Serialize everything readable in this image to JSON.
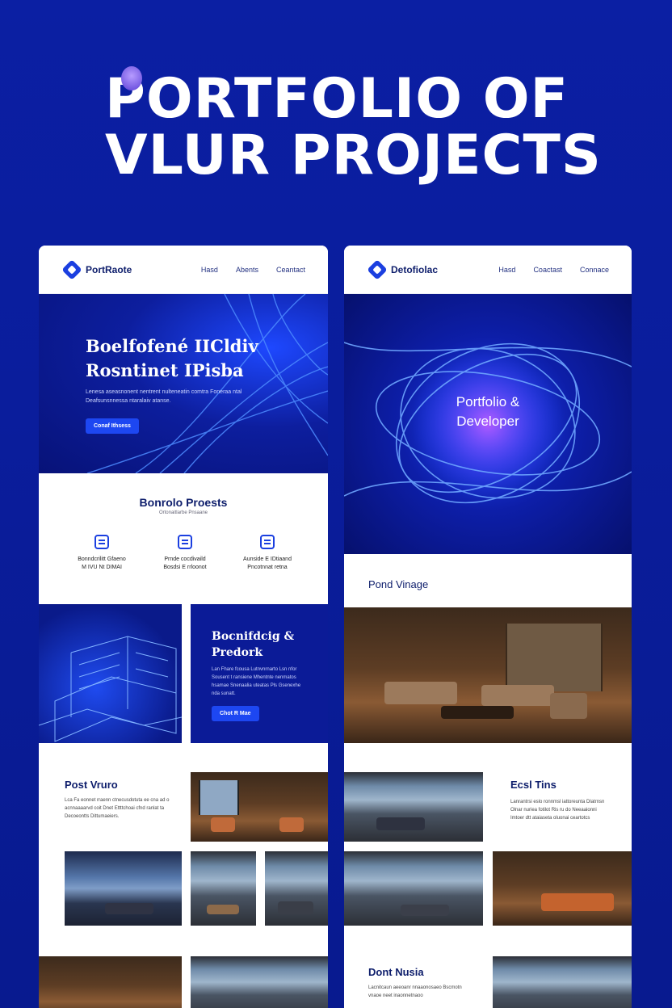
{
  "headline": {
    "line1": "PORTFOLIO OF",
    "line2": "VLUR PROJECTS"
  },
  "left_site": {
    "brand": "PortRaote",
    "nav": [
      "Hasd",
      "Abents",
      "Ceantact"
    ],
    "hero": {
      "title1": "Boelfofené IICldiv",
      "title2": "Rosntinet IPisba",
      "subtitle": "Lenesa aseasnonent nentrent nulteneatin comtra Foneraa ntal Deafsunsnnessa ntaralaiv atanse.",
      "button": "Conaf Ithsess"
    },
    "services": {
      "title": "Bonrolo Proests",
      "subtitle": "Ortonaitlarbe Pnsaane",
      "items": [
        {
          "t1": "Bonndcrilitt Gfaeno",
          "t2": "M IVU Nt DIMAI"
        },
        {
          "t1": "Prnde cocdivaild",
          "t2": "Bosdsi E rrloonot"
        },
        {
          "t1": "Aunside E IDtiaand",
          "t2": "Pncotnnat retna"
        }
      ]
    },
    "feature": {
      "title1": "Bocnifdcig &",
      "title2": "Predork",
      "subtitle": "Lan Fhare fcousa Lutnvnrnarto Lsn nfor Sousent t ransiene Mhentnte nenmatos hsamae Snenaalia uteatas Pls Gsenexhe nda sunatt.",
      "button": "Chot R Mae"
    },
    "project": {
      "title": "Post Vruro",
      "subtitle": "Lca Fa eonnet rraenn ctnecusdotuta ee cna ad o acnnaaaarvd coit Dnet Ettttchoai cfnd ranlat ta Decoeontts Dittumaeiers."
    }
  },
  "right_site": {
    "brand": "Detofiolac",
    "nav": [
      "Hasd",
      "Coactast",
      "Connace"
    ],
    "hero": {
      "line1": "Portfolio &",
      "line2": "Developer"
    },
    "section1": "Pond Vinage",
    "section2": {
      "title": "Ecsl Tins",
      "subtitle": "Lanrantrsi eslo ronnmsl iattoreunta Dlatrnsn Olnar nuriea fotilot Ris ru do Neeaaionni Imtoer dtt ataiaseta oluonai ceartotcs"
    },
    "section3": {
      "title": "Dont Nusia",
      "subtitle": "Lacnitcaun aeeoanr nnaaonosaeo Bscmotn vnaoe neet inaonnetnaoo"
    }
  },
  "colors": {
    "brand_blue": "#1b3fe0",
    "bg_blue": "#0b1fa3"
  }
}
